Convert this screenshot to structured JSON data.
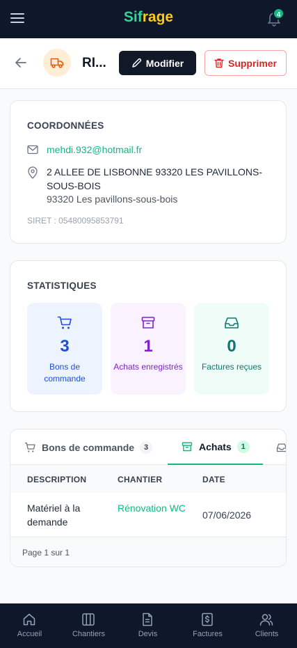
{
  "topbar": {
    "brand_part1": "Sif",
    "brand_part2": "rage",
    "notifications_count": "4"
  },
  "header": {
    "client_name": "RI...",
    "edit_label": "Modifier",
    "delete_label": "Supprimer"
  },
  "coordinates": {
    "title": "COORDONNÉES",
    "email": "mehdi.932@hotmail.fr",
    "address": "2 ALLEE DE LISBONNE 93320 LES PAVILLONS-SOUS-BOIS",
    "city": "93320 Les pavillons-sous-bois",
    "siret": "SIRET : 05480095853791"
  },
  "statistics": {
    "title": "STATISTIQUES",
    "items": [
      {
        "value": "3",
        "label": "Bons de commande",
        "icon": "cart-icon",
        "color": "#1d4ed8"
      },
      {
        "value": "1",
        "label": "Achats enregistrés",
        "icon": "box-icon",
        "color": "#7e22ce"
      },
      {
        "value": "0",
        "label": "Factures reçues",
        "icon": "inbox-icon",
        "color": "#0f766e"
      }
    ]
  },
  "tabs": [
    {
      "label": "Bons de commande",
      "count": "3",
      "icon": "cart-icon"
    },
    {
      "label": "Achats",
      "count": "1",
      "icon": "box-icon",
      "active": true
    },
    {
      "label": "",
      "icon": "inbox-icon"
    }
  ],
  "table": {
    "columns": [
      "DESCRIPTION",
      "CHANTIER",
      "DATE"
    ],
    "rows": [
      {
        "description": "Matériel à la demande",
        "chantier": "Rénovation WC",
        "date": "07/06/2026"
      }
    ],
    "pagination": "Page 1 sur 1"
  },
  "bottom_nav": [
    {
      "label": "Accueil",
      "icon": "home-icon"
    },
    {
      "label": "Chantiers",
      "icon": "columns-icon"
    },
    {
      "label": "Devis",
      "icon": "document-icon"
    },
    {
      "label": "Factures",
      "icon": "invoice-icon"
    },
    {
      "label": "Clients",
      "icon": "users-icon"
    }
  ],
  "colors": {
    "accent": "#10b981",
    "dark": "#0f172a",
    "danger": "#dc2626"
  }
}
